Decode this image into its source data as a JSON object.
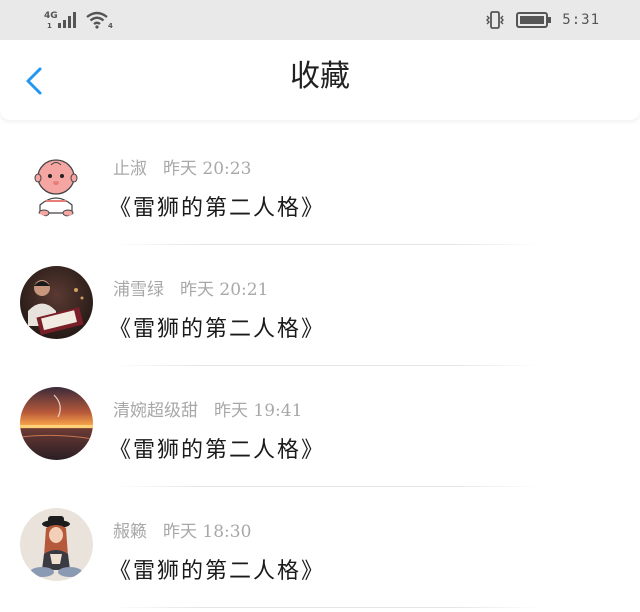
{
  "status_bar": {
    "network": "4G",
    "signal_sub": "1",
    "wifi_sub": "4",
    "time": "5:31"
  },
  "header": {
    "title": "收藏",
    "back_icon": "chevron-left-icon"
  },
  "colors": {
    "accent": "#2196f3",
    "title": "#222222",
    "meta": "#a8a8a8",
    "status_bar_bg": "#e9e9e9"
  },
  "favorites": [
    {
      "author": "止淑",
      "time": "昨天 20:23",
      "content": "《雷狮的第二人格》",
      "avatar": "baby-avatar"
    },
    {
      "author": "浦雪绿",
      "time": "昨天 20:21",
      "content": "《雷狮的第二人格》",
      "avatar": "photo-avatar"
    },
    {
      "author": "清婉超级甜",
      "time": "昨天 19:41",
      "content": "《雷狮的第二人格》",
      "avatar": "sunset-avatar"
    },
    {
      "author": "赧籁",
      "time": "昨天 18:30",
      "content": "《雷狮的第二人格》",
      "avatar": "girl-avatar"
    }
  ]
}
